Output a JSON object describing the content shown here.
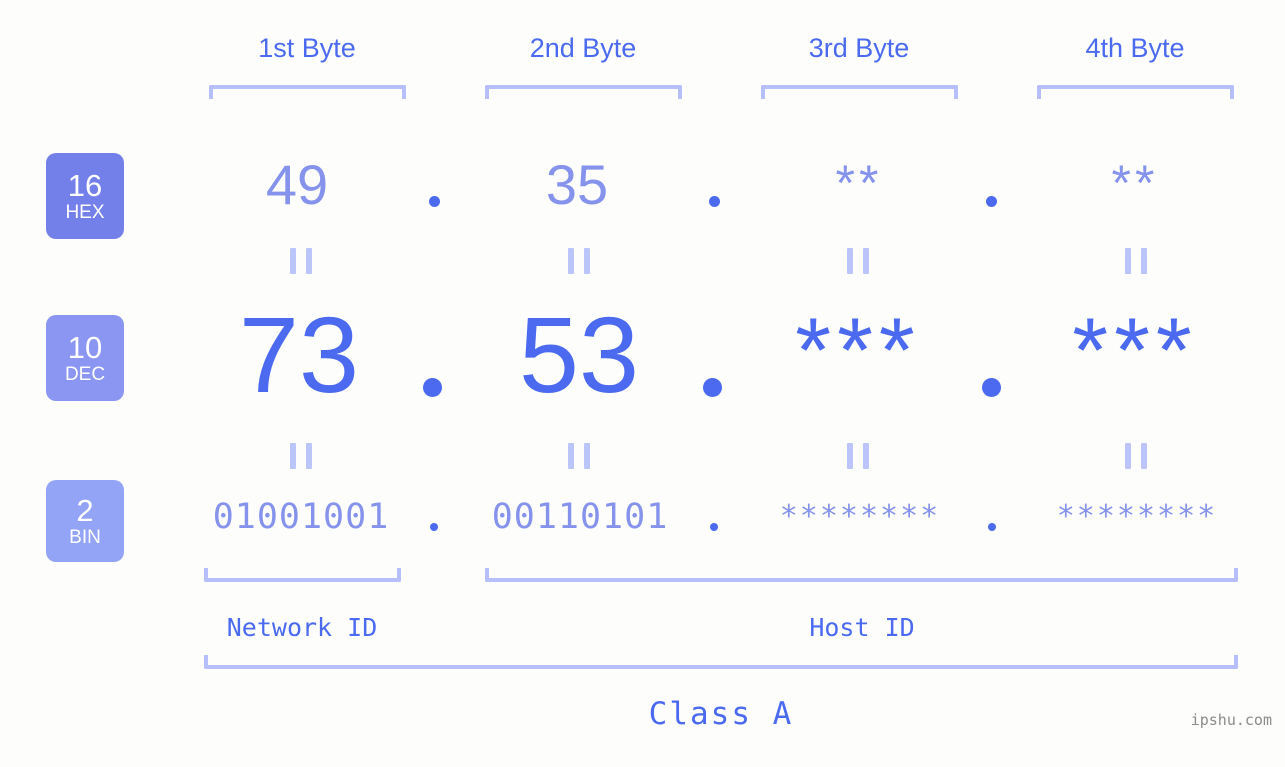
{
  "background_color": "#fdfefb",
  "colors": {
    "accent_strong": "#4b6aef",
    "accent_light": "#8693ec",
    "bracket": "#b6bffa",
    "badge_hex": "#7480ea",
    "badge_dec": "#8b96f2",
    "badge_bin": "#93a4f7",
    "watermark": "#8b8b8b"
  },
  "byte_headers": [
    {
      "label": "1st Byte"
    },
    {
      "label": "2nd Byte"
    },
    {
      "label": "3rd Byte"
    },
    {
      "label": "4th Byte"
    }
  ],
  "bases": [
    {
      "number": "16",
      "name": "HEX"
    },
    {
      "number": "10",
      "name": "DEC"
    },
    {
      "number": "2",
      "name": "BIN"
    }
  ],
  "rows": {
    "hex": {
      "values": [
        "49",
        "35",
        "**",
        "**"
      ]
    },
    "dec": {
      "values": [
        "73",
        "53",
        "***",
        "***"
      ]
    },
    "bin": {
      "values": [
        "01001001",
        "00110101",
        "********",
        "********"
      ]
    }
  },
  "separators": {
    "dot": ".",
    "equals": "||"
  },
  "segments": {
    "network_id": "Network ID",
    "host_id": "Host ID",
    "class": "Class A"
  },
  "watermark": "ipshu.com"
}
